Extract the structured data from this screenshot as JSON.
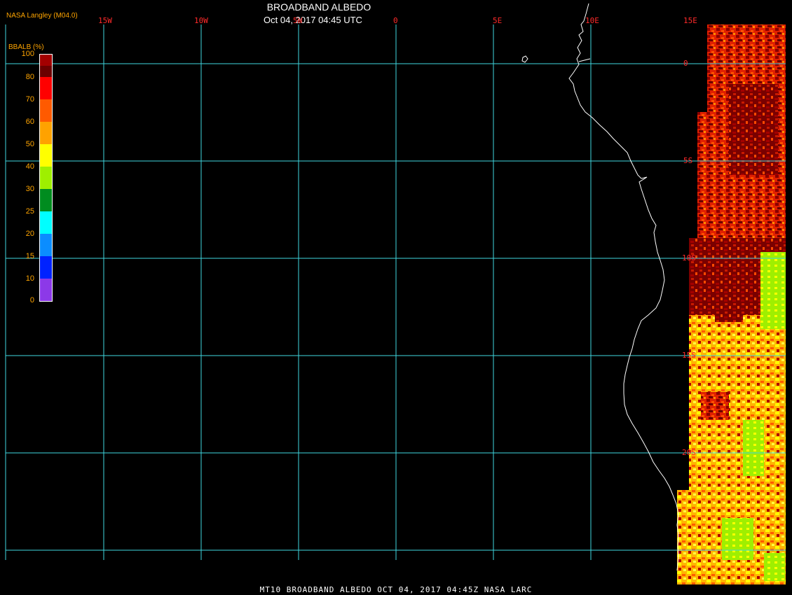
{
  "header": {
    "title": "BROADBAND ALBEDO",
    "subtitle": "Oct 04, 2017 04:45 UTC",
    "credit": "NASA Langley (M04.0)"
  },
  "footer": {
    "caption": "MT10  BROADBAND ALBEDO   OCT 04, 2017 04:45Z   NASA LARC"
  },
  "colorbar": {
    "title": "BBALB (%)",
    "ticks": [
      "100",
      "80",
      "70",
      "60",
      "50",
      "40",
      "30",
      "25",
      "20",
      "15",
      "10",
      "0"
    ],
    "colors": [
      "#a30000",
      "#6b0000",
      "#ff0000",
      "#ff5a00",
      "#ffa200",
      "#ffff00",
      "#9fef00",
      "#008c1f",
      "#00ffff",
      "#0b8dff",
      "#0022ff",
      "#8c39e8"
    ]
  },
  "map": {
    "longitude_labels": [
      "15W",
      "10W",
      "5W",
      "0",
      "5E",
      "10E",
      "15E"
    ],
    "latitude_labels": [
      "0",
      "5S",
      "10S",
      "15S",
      "20S"
    ],
    "grid_color": "#3fd7e0",
    "coast_color": "#ffffff",
    "label_color": "#ff2a2a"
  }
}
